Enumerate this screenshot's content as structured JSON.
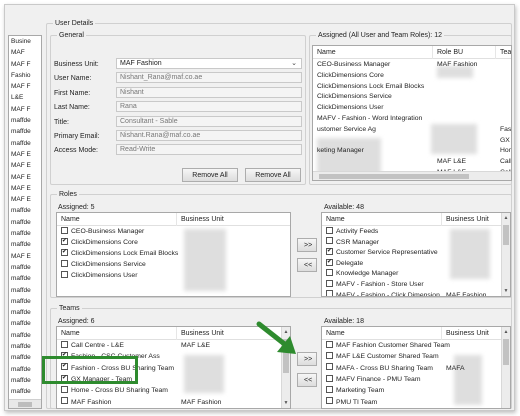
{
  "left_list": {
    "items": [
      "Busine",
      "MAF",
      "MAF F",
      "Fashio",
      "MAF F",
      "L&E",
      "MAF F",
      "maffde",
      "maffde",
      "maffde",
      "MAF E",
      "MAF E",
      "MAF E",
      "MAF E",
      "MAF E",
      "maffde",
      "maffde",
      "maffde",
      "maffde",
      "MAF E",
      "maffde",
      "maffde",
      "maffde",
      "maffde",
      "maffde",
      "maffde",
      "maffde",
      "maffde",
      "maffde",
      "maffde",
      "maffde",
      "maffde",
      "maffde"
    ]
  },
  "user_details": {
    "title": "User Details"
  },
  "general": {
    "title": "General",
    "labels": {
      "business_unit": "Business Unit:",
      "user_name": "User Name:",
      "first_name": "First Name:",
      "last_name": "Last Name:",
      "title": "Title:",
      "primary_email": "Primary Email:",
      "access_mode": "Access Mode:"
    },
    "values": {
      "business_unit": "MAF Fashion",
      "user_name": "Nishant_Rana@maf.co.ae",
      "first_name": "Nishant",
      "last_name": "Rana",
      "title": "Consultant - Sable",
      "primary_email": "Nishant.Rana@maf.co.ae",
      "access_mode": "Read-Write"
    },
    "remove_all_1": "Remove All",
    "remove_all_2": "Remove All"
  },
  "assigned_all": {
    "title": "Assigned (All User and Team Roles): 12",
    "columns": [
      "Name",
      "Role BU",
      "Team"
    ],
    "rows": [
      {
        "name": "CEO-Business Manager",
        "bu": "MAF Fashion",
        "team": ""
      },
      {
        "name": "ClickDimensions Core",
        "bu": "",
        "team": ""
      },
      {
        "name": "ClickDimensions Lock Email Blocks",
        "bu": "",
        "team": ""
      },
      {
        "name": "ClickDimensions Service",
        "bu": "",
        "team": ""
      },
      {
        "name": "ClickDimensions User",
        "bu": "",
        "team": ""
      },
      {
        "name": "MAFV - Fashion - Word Integration",
        "bu": "",
        "team": ""
      },
      {
        "name": "ustomer Service Ag",
        "bu": "",
        "team": "Fashi"
      },
      {
        "name": "",
        "bu": "",
        "team": "GX M"
      },
      {
        "name": "keting Manager",
        "bu": "",
        "team": "Home"
      },
      {
        "name": "",
        "bu": "MAF L&E",
        "team": "Call C"
      },
      {
        "name": "",
        "bu": "MAF L&E",
        "team": "Call C"
      }
    ]
  },
  "roles": {
    "title": "Roles",
    "assigned_label": "Assigned: 5",
    "available_label": "Available: 48",
    "col_name": "Name",
    "col_bu": "Business Unit",
    "assigned": [
      {
        "name": "CEO-Business Manager",
        "checked": false
      },
      {
        "name": "ClickDimensions Core",
        "checked": true
      },
      {
        "name": "ClickDimensions Lock Email Blocks",
        "checked": true
      },
      {
        "name": "ClickDimensions Service",
        "checked": false
      },
      {
        "name": "ClickDimensions User",
        "checked": false
      }
    ],
    "available": [
      {
        "name": "Activity Feeds",
        "checked": false,
        "bu": ""
      },
      {
        "name": "CSR Manager",
        "checked": false,
        "bu": ""
      },
      {
        "name": "Customer Service Representative",
        "checked": true,
        "bu": ""
      },
      {
        "name": "Delegate",
        "checked": true,
        "bu": ""
      },
      {
        "name": "Knowledge Manager",
        "checked": false,
        "bu": ""
      },
      {
        "name": "MAFV - Fashion - Store User",
        "checked": false,
        "bu": ""
      },
      {
        "name": "MAFV - Fashion - Click Dimension ...",
        "checked": false,
        "bu": "MAF Fashion"
      }
    ],
    "add_btn": ">>",
    "remove_btn": "<<"
  },
  "teams": {
    "title": "Teams",
    "assigned_label": "Assigned: 6",
    "available_label": "Available: 18",
    "col_name": "Name",
    "col_bu": "Business Unit",
    "assigned": [
      {
        "name": "Call Centre - L&E",
        "checked": false,
        "bu": "MAF L&E"
      },
      {
        "name": "Fashion - CSC Customer Ass",
        "checked": true,
        "bu": ""
      },
      {
        "name": "Fashion - Cross BU Sharing Team",
        "checked": true,
        "bu": ""
      },
      {
        "name": "GX Manager - Team",
        "checked": true,
        "bu": ""
      },
      {
        "name": "Home - Cross BU Sharing Team",
        "checked": false,
        "bu": ""
      },
      {
        "name": "MAF Fashion",
        "checked": false,
        "bu": "MAF Fashion"
      }
    ],
    "available": [
      {
        "name": "MAF Fashion Customer Shared Team",
        "checked": false,
        "bu": ""
      },
      {
        "name": "MAF L&E Customer Shared Team",
        "checked": false,
        "bu": ""
      },
      {
        "name": "MAFA - Cross BU Sharing Team",
        "checked": false,
        "bu": "MAFA"
      },
      {
        "name": "MAFV Finance - PMU Team",
        "checked": false,
        "bu": ""
      },
      {
        "name": "Marketing Team",
        "checked": false,
        "bu": ""
      },
      {
        "name": "PMU TI Team",
        "checked": false,
        "bu": ""
      }
    ],
    "add_btn": ">>",
    "remove_btn": "<<"
  },
  "colors": {
    "highlight": "#2e8b2e",
    "arrow": "#2e8b2e"
  }
}
